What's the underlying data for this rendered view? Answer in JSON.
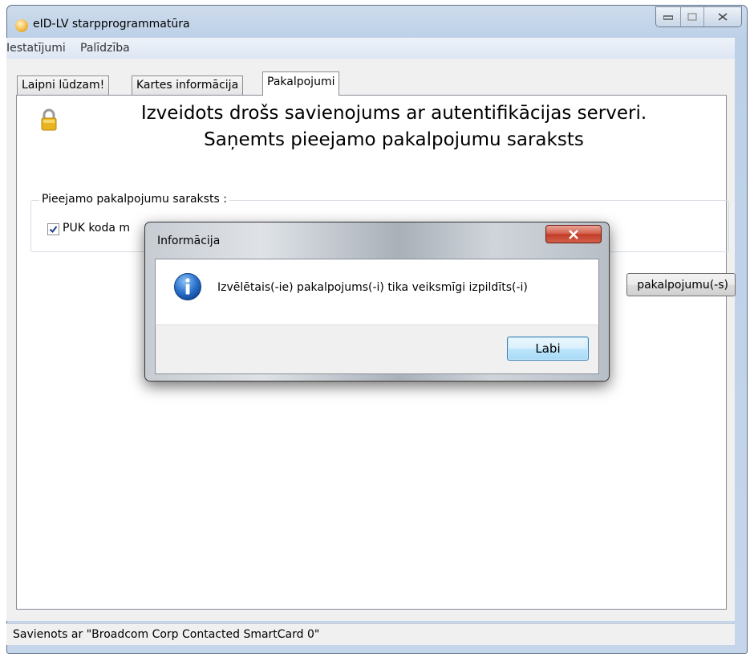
{
  "window": {
    "title": "eID-LV starpprogrammatūra"
  },
  "menubar": {
    "items": [
      "Iestatījumi",
      "Palīdzība"
    ]
  },
  "tabs": [
    {
      "label": "Laipni lūdzam!"
    },
    {
      "label": "Kartes informācija"
    },
    {
      "label": "Pakalpojumi"
    }
  ],
  "panel": {
    "headline_line1": "Izveidots drošs savienojums ar autentifikācijas serveri.",
    "headline_line2": "Saņemts pieejamo pakalpojumu saraksts",
    "group_label": "Pieejamo pakalpojumu saraksts :",
    "service_label": "PUK koda m",
    "service_checked": true,
    "execute_button_label": "pakalpojumu(-s)"
  },
  "status": {
    "text": "Savienots ar \"Broadcom Corp Contacted SmartCard 0\""
  },
  "dialog": {
    "title": "Informācija",
    "message": "Izvēlētais(-ie) pakalpojums(-i) tika veiksmīgi izpildīts(-i)",
    "ok_label": "Labi",
    "icon": "info-icon"
  },
  "colors": {
    "dialog_close": "#c8432d",
    "info_icon": "#1f5fb8",
    "lock": "#e8b420"
  }
}
